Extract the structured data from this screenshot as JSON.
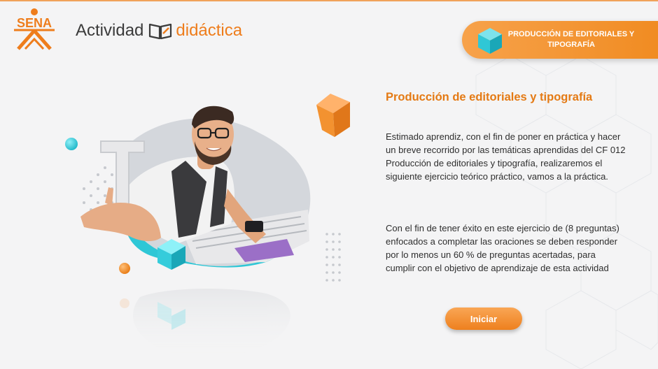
{
  "header": {
    "logo_text": "SENA",
    "brand_part1": "Actividad",
    "brand_part2": "didáctica",
    "topic_badge": "PRODUCCIÓN DE EDITORIALES Y TIPOGRAFÍA"
  },
  "content": {
    "title": "Producción de editoriales y tipografía",
    "paragraph1": "Estimado aprendiz, con el fin de poner en práctica y hacer un breve recorrido por las temáticas aprendidas del CF 012 Producción de editoriales y tipografía, realizaremos el siguiente ejercicio teórico práctico, vamos a la práctica.",
    "paragraph2": "Con el fin de tener éxito en este ejercicio de (8 preguntas) enfocados a completar las oraciones se deben responder por lo menos un 60 % de preguntas acertadas, para cumplir con el objetivo de aprendizaje de esta actividad",
    "start_button": "Iniciar"
  },
  "illustration": {
    "letter": "T"
  },
  "colors": {
    "accent": "#ee7d1c",
    "teal": "#2fc7d6",
    "background": "#f4f4f5",
    "text": "#2e2e2e"
  },
  "icons": [
    "sena-logo",
    "book-icon",
    "cube-icon"
  ]
}
